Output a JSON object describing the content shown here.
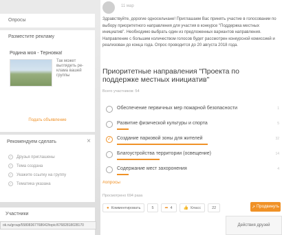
{
  "left": {
    "top_item": "Опросы",
    "ads": {
      "header": "Разместите рекламу",
      "ad_title": "Родина моя - Терновка!",
      "ad_text": "Так может выглядеть ре-клама вашей группы",
      "link": "Подать объявление"
    },
    "recommend": {
      "header": "Рекомендуем сделать",
      "close": "×",
      "items": [
        "Друзья приглашены",
        "Тема создана",
        "Укажите ссылку на группу",
        "Тематика указана"
      ]
    },
    "participants_header": "Участники",
    "url": "ok.ru/group/55808367768642/topic/67682818028170"
  },
  "post": {
    "stamp": "11 мар",
    "intro": "Здравствуйте, дорогие односельчане! Приглашаем Вас принять участие в голосовании по выбору приоритетного направления для участия в конкурсе \"Поддержка местных инициатив\". Необходимо выбрать один из предложенных вариантов направления. Направление с большим количеством голосов будет рассмотрен конкурсной комиссией и реализован до конца года. Опрос проводится до 20 августа 2018 года.",
    "poll_title": "Приоритетные направления \"Проекта по поддержке местных инициатив\"",
    "participants": "Всего участников: 54",
    "options": [
      {
        "label": "Обеспечение первичных мер пожарной безопасности",
        "fraction": 0.0,
        "count": "1",
        "selected": false
      },
      {
        "label": "Развитие физической культуры и спорта",
        "fraction": 0.07,
        "count": "5",
        "selected": false
      },
      {
        "label": "Создание парковой зоны для жителей",
        "fraction": 0.55,
        "count": "32",
        "selected": true
      },
      {
        "label": "Благоустройства территории (освещение)",
        "fraction": 0.26,
        "count": "14",
        "selected": false
      },
      {
        "label": "Содержание мест захоронения",
        "fraction": 0.07,
        "count": "4",
        "selected": false
      }
    ],
    "hashtag": "#опросы",
    "views": "Просмотрено 694 раза",
    "actions": {
      "comment": "Комментировать",
      "comment_count": "5",
      "share_count": "4",
      "like": "Класс",
      "like_count": "22"
    },
    "promote": "Продвинуть",
    "friends": "Действия друзей"
  },
  "colors": {
    "accent": "#ee8208"
  }
}
